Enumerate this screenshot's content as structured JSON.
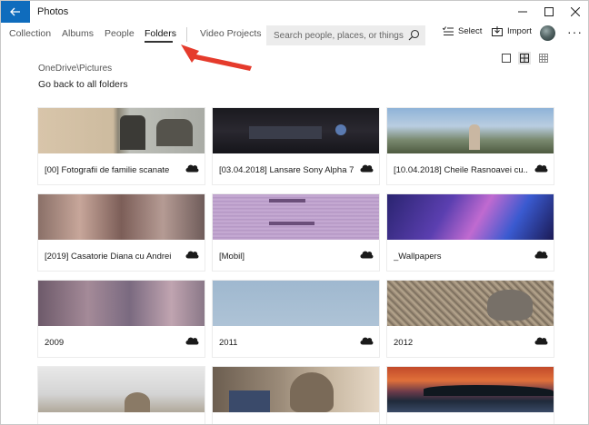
{
  "window": {
    "title": "Photos"
  },
  "nav": {
    "tabs": [
      "Collection",
      "Albums",
      "People",
      "Folders",
      "Video Projects"
    ],
    "active_tab": "Folders",
    "search_placeholder": "Search people, places, or things",
    "select_label": "Select",
    "import_label": "Import"
  },
  "breadcrumb": {
    "path": "OneDrive\\Pictures",
    "go_back": "Go back to all folders"
  },
  "colors": {
    "accent": "#0f6cbd",
    "annotation_arrow": "#e53b2c"
  },
  "folders": [
    {
      "name": "[00] Fotografii de familie scanate",
      "thumb": "family-sepia"
    },
    {
      "name": "[03.04.2018] Lansare Sony Alpha 7...",
      "thumb": "dark-stage"
    },
    {
      "name": "[10.04.2018] Cheile Rasnoavei cu...",
      "thumb": "landscape-sky"
    },
    {
      "name": "[2019] Casatorie Diana cu Andrei",
      "thumb": "blurred-wedding"
    },
    {
      "name": "[Mobil]",
      "thumb": "phone-screen"
    },
    {
      "name": "_Wallpapers",
      "thumb": "galaxy"
    },
    {
      "name": "2009",
      "thumb": "blurred-party"
    },
    {
      "name": "2011",
      "thumb": "blue-sky"
    },
    {
      "name": "2012",
      "thumb": "cat-closeup"
    },
    {
      "name": "",
      "thumb": "cat-window"
    },
    {
      "name": "",
      "thumb": "cat-laptop"
    },
    {
      "name": "",
      "thumb": "sunset-lake"
    }
  ]
}
